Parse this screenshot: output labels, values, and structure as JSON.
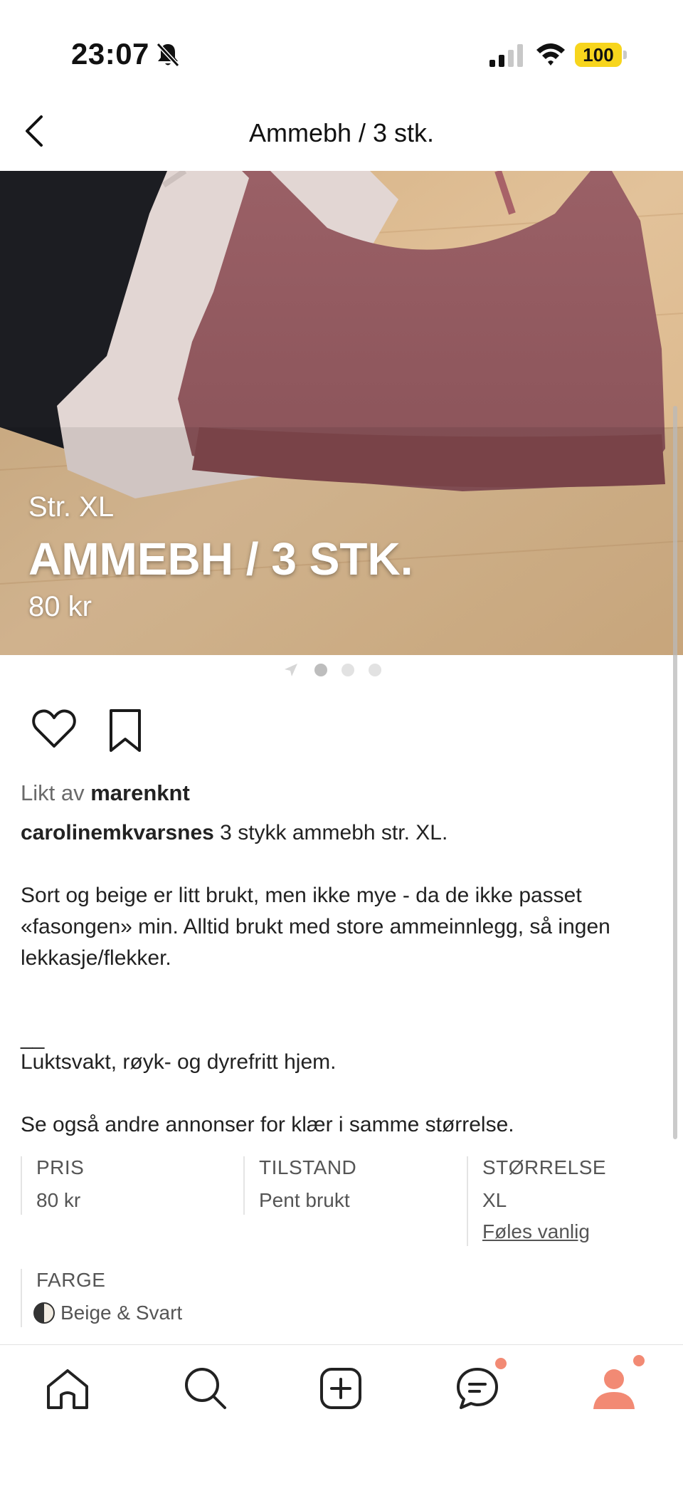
{
  "status_bar": {
    "time": "23:07",
    "battery": "100",
    "icons": [
      "bell-muted-icon",
      "signal-icon",
      "wifi-icon",
      "battery-icon"
    ]
  },
  "nav": {
    "title": "Ammebh / 3 stk.",
    "back_icon": "chevron-left-icon"
  },
  "hero": {
    "size": "Str. XL",
    "title": "AMMEBH / 3 STK.",
    "price": "80 kr",
    "image_count": 3,
    "active_index": 0
  },
  "actions": {
    "icons": [
      "heart-icon",
      "bookmark-icon"
    ]
  },
  "likes": {
    "prefix": "Likt av",
    "user": "marenknt"
  },
  "description": {
    "seller": "carolinemkvarsnes",
    "first_line": " 3 stykk ammebh str. XL.",
    "paragraph1": "Sort og beige er litt brukt, men ikke mye - da de ikke passet «fasongen» min. Alltid brukt med store ammeinnlegg, så ingen lekkasje/flekker.",
    "separator": "__",
    "paragraph2": "Luktsvakt, røyk- og dyrefritt hjem.",
    "paragraph3": "Se også andre annonser for klær i samme størrelse."
  },
  "attributes": {
    "price_label": "PRIS",
    "price_value": "80 kr",
    "condition_label": "TILSTAND",
    "condition_value": "Pent brukt",
    "size_label": "STØRRELSE",
    "size_value": "XL",
    "size_link": "Føles vanlig",
    "color_label": "FARGE",
    "color_value": "Beige & Svart"
  },
  "colors": {
    "accent": "#f28a74",
    "battery": "#f7d51d"
  },
  "tabbar": {
    "tabs": [
      "home-icon",
      "search-icon",
      "add-icon",
      "messages-icon",
      "profile-icon"
    ]
  }
}
